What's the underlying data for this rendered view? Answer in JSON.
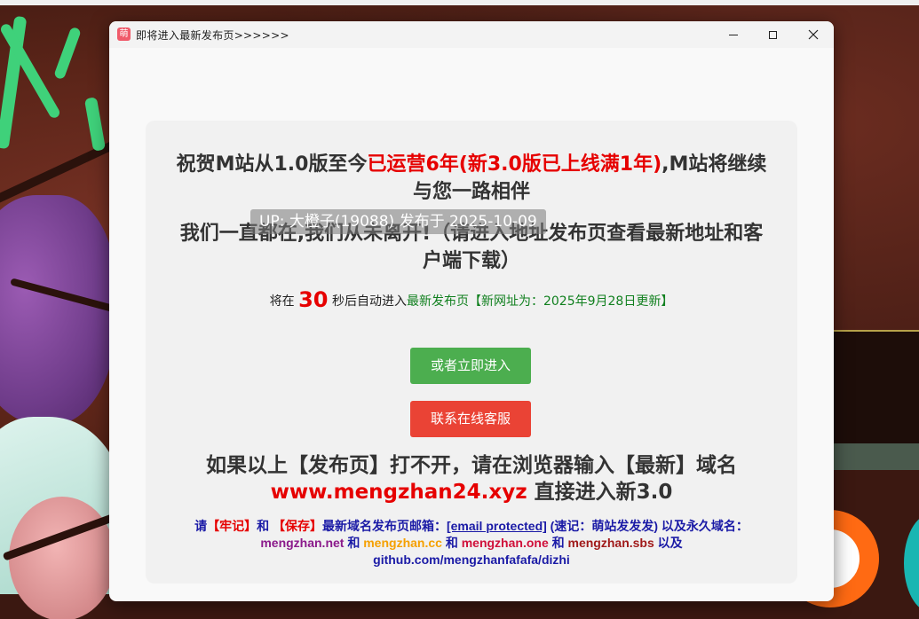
{
  "window": {
    "title": "即将进入最新发布页>>>>>>",
    "app_icon_glyph": "萌",
    "controls": {
      "minimize": "minimize-icon",
      "maximize": "maximize-icon",
      "close": "close-icon"
    }
  },
  "panel": {
    "headline_part1": "祝贺M站从1.0版至今",
    "headline_highlight": "已运营6年(新3.0版已上线满1年)",
    "headline_part2": ",M站将继续与您一路相伴",
    "headline2": "我们一直都在,我们从未离开!（请进入地址发布页查看最新地址和客户端下载）",
    "overlay_badge": "UP: 大橙子(19088) 发布于 2025-10-09",
    "countdown_prefix": "将在",
    "countdown_seconds": "30",
    "countdown_suffix": "秒后自动进入",
    "countdown_link": "最新发布页【新网址为：2025年9月28日更新】",
    "enter_button": "或者立即进入",
    "service_button": "联系在线客服",
    "fallback_line1": "如果以上【发布页】打不开，请在浏览器输入【最新】域名",
    "fallback_domain": "www.mengzhan24.xyz",
    "fallback_line2_suffix": " 直接进入新3.0",
    "info_prefix": "请",
    "info_remember": "【牢记】",
    "info_and1": "和 ",
    "info_save": "【保存】",
    "info_mailbox": "最新域名发布页邮箱：",
    "info_email": "[email protected]",
    "info_mnemonic": " (速记：萌站发发发) 以及永久域名：",
    "domain1": "mengzhan.net",
    "and": " 和 ",
    "domain2": "mengzhan.cc",
    "domain3": "mengzhan.one",
    "domain4": "mengzhan.sbs",
    "info_and_also": " 以及",
    "github": "github.com/mengzhanfafafa/dizhi"
  },
  "colors": {
    "accent_red": "#e60000",
    "button_green": "#4cae4f",
    "button_red": "#ea4335",
    "info_blue": "#1a1aa6"
  }
}
